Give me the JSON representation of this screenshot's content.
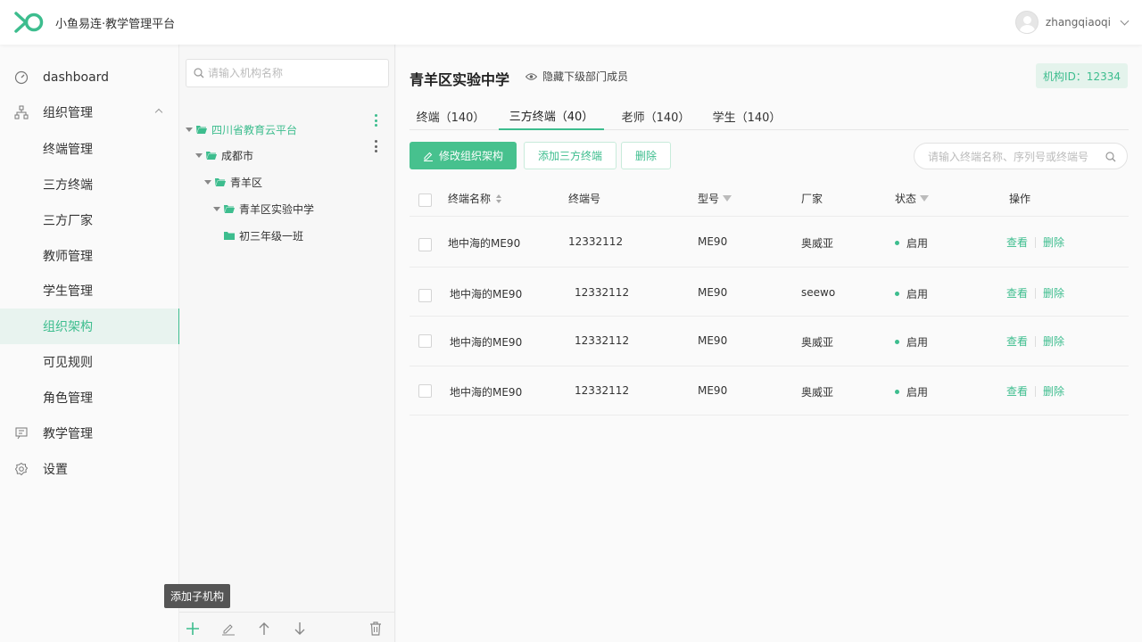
{
  "header": {
    "app_title": "小鱼易连·教学管理平台",
    "username": "zhangqiaoqi",
    "brand_color": "#3dbd8e"
  },
  "sidebar": {
    "items": [
      {
        "label": "dashboard",
        "icon": "dashboard-icon"
      },
      {
        "label": "组织管理",
        "icon": "org-tree-icon",
        "expanded": true
      },
      {
        "label": "终端管理"
      },
      {
        "label": "三方终端"
      },
      {
        "label": "三方厂家"
      },
      {
        "label": "教师管理"
      },
      {
        "label": "学生管理"
      },
      {
        "label": "组织架构",
        "active": true
      },
      {
        "label": "可见规则"
      },
      {
        "label": "角色管理"
      },
      {
        "label": "教学管理",
        "icon": "teaching-icon"
      },
      {
        "label": "设置",
        "icon": "gear-icon"
      }
    ]
  },
  "tree": {
    "search_placeholder": "请输入机构名称",
    "nodes": [
      {
        "label": "四川省教育云平台",
        "selected": true
      },
      {
        "label": "成都市"
      },
      {
        "label": "青羊区"
      },
      {
        "label": "青羊区实验中学"
      },
      {
        "label": "初三年级一班"
      }
    ],
    "toolbar_tooltip": "添加子机构"
  },
  "main": {
    "org_title": "青羊区实验中学",
    "hide_sub_label": "隐藏下级部门成员",
    "org_id_label": "机构ID：12334",
    "tabs": [
      {
        "label": "终端（140）"
      },
      {
        "label": "三方终端（40）",
        "active": true
      },
      {
        "label": "老师（140）"
      },
      {
        "label": "学生（140）"
      }
    ],
    "buttons": {
      "edit_org": "修改组织架构",
      "add_third": "添加三方终端",
      "delete": "删除"
    },
    "search_placeholder": "请输入终端名称、序列号或终端号",
    "table": {
      "headers": {
        "name": "终端名称",
        "number": "终端号",
        "model": "型号",
        "vendor": "厂家",
        "status": "状态",
        "actions": "操作"
      },
      "rows": [
        {
          "name": "地中海的ME90",
          "number": "12332112",
          "model": "ME90",
          "vendor": "奥威亚",
          "status": "启用",
          "view": "查看",
          "delete": "删除"
        },
        {
          "name": "地中海的ME90",
          "number": "12332112",
          "model": "ME90",
          "vendor": "seewo",
          "status": "启用",
          "view": "查看",
          "delete": "删除"
        },
        {
          "name": "地中海的ME90",
          "number": "12332112",
          "model": "ME90",
          "vendor": "奥威亚",
          "status": "启用",
          "view": "查看",
          "delete": "删除"
        },
        {
          "name": "地中海的ME90",
          "number": "12332112",
          "model": "ME90",
          "vendor": "奥威亚",
          "status": "启用",
          "view": "查看",
          "delete": "删除"
        }
      ]
    }
  }
}
